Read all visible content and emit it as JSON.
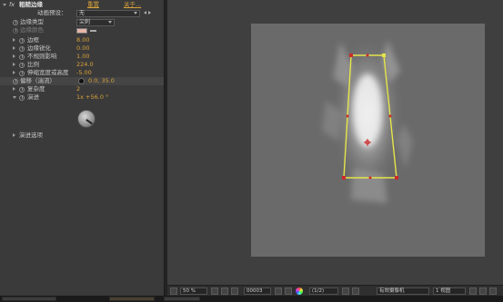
{
  "effect_panel": {
    "fx_symbol": "fx",
    "effect_name": "粗糙边缘",
    "reset_label": "重置",
    "about_label": "关于...",
    "preset_label": "动画预设：",
    "preset_value": "无",
    "properties": [
      {
        "label": "边缘类型",
        "value": "尖刺"
      },
      {
        "label": "边缘颜色",
        "value": ""
      },
      {
        "label": "边框",
        "value": "8.00"
      },
      {
        "label": "边缘锐化",
        "value": "0.00"
      },
      {
        "label": "不规则影响",
        "value": "1.00"
      },
      {
        "label": "比例",
        "value": "224.0"
      },
      {
        "label": "伸缩宽度或高度",
        "value": "-5.00"
      },
      {
        "label": "偏移（湍流）",
        "value": "0.0, 35.0"
      },
      {
        "label": "复杂度",
        "value": "2"
      },
      {
        "label": "演进",
        "value": "1x +56.0 °"
      }
    ],
    "more_options": "演进选项"
  },
  "viewer": {
    "zoom": "50 %",
    "timecode": "00003",
    "resolution": "(1/2)",
    "camera": "有效摄像机",
    "views": "1 视图"
  },
  "colors": {
    "panel_bg": "#3a3a3a",
    "viewer_bg": "#3f3f3f",
    "canvas_bg": "#6a6a6a",
    "value_orange": "#d9a23a",
    "mask_yellow": "#e5e54a",
    "vertex_red": "#cc2a2a"
  },
  "icons": [
    "fx-icon",
    "stopwatch-icon",
    "eyedropper-icon",
    "crosshair-icon",
    "evolution-dial",
    "snapshot-icon",
    "color-wheel-icon"
  ]
}
